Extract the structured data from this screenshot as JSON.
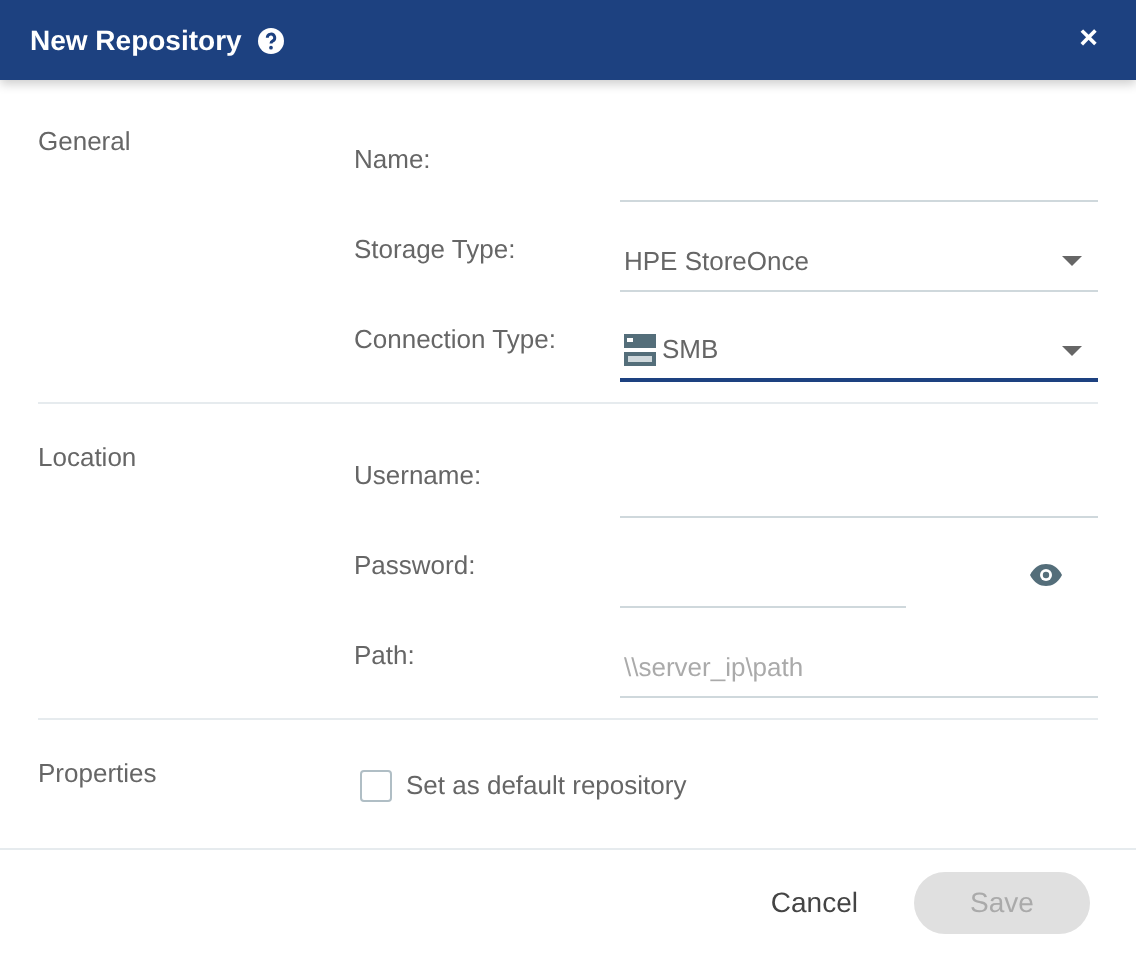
{
  "dialog": {
    "title": "New Repository",
    "close": "×"
  },
  "sections": [
    {
      "label": "General",
      "fields": [
        {
          "kind": "text",
          "label": "Name:"
        },
        {
          "kind": "select",
          "label": "Storage Type:",
          "value": "HPE StoreOnce",
          "focused": false
        },
        {
          "kind": "select",
          "label": "Connection Type:",
          "value": "SMB",
          "has_icon": true,
          "focused": true
        }
      ]
    },
    {
      "label": "Location",
      "fields": [
        {
          "kind": "text",
          "label": "Username:"
        },
        {
          "kind": "password",
          "label": "Password:"
        },
        {
          "kind": "text",
          "label": "Path:",
          "placeholder": "\\\\server_ip\\path"
        }
      ]
    },
    {
      "label": "Properties",
      "fields": [
        {
          "kind": "checkbox",
          "label": "Set as default repository",
          "checked": false
        }
      ]
    }
  ],
  "buttons": [
    {
      "label": "Cancel",
      "kind": "text",
      "disabled": false
    },
    {
      "label": "Save",
      "kind": "filled",
      "disabled": true
    }
  ]
}
